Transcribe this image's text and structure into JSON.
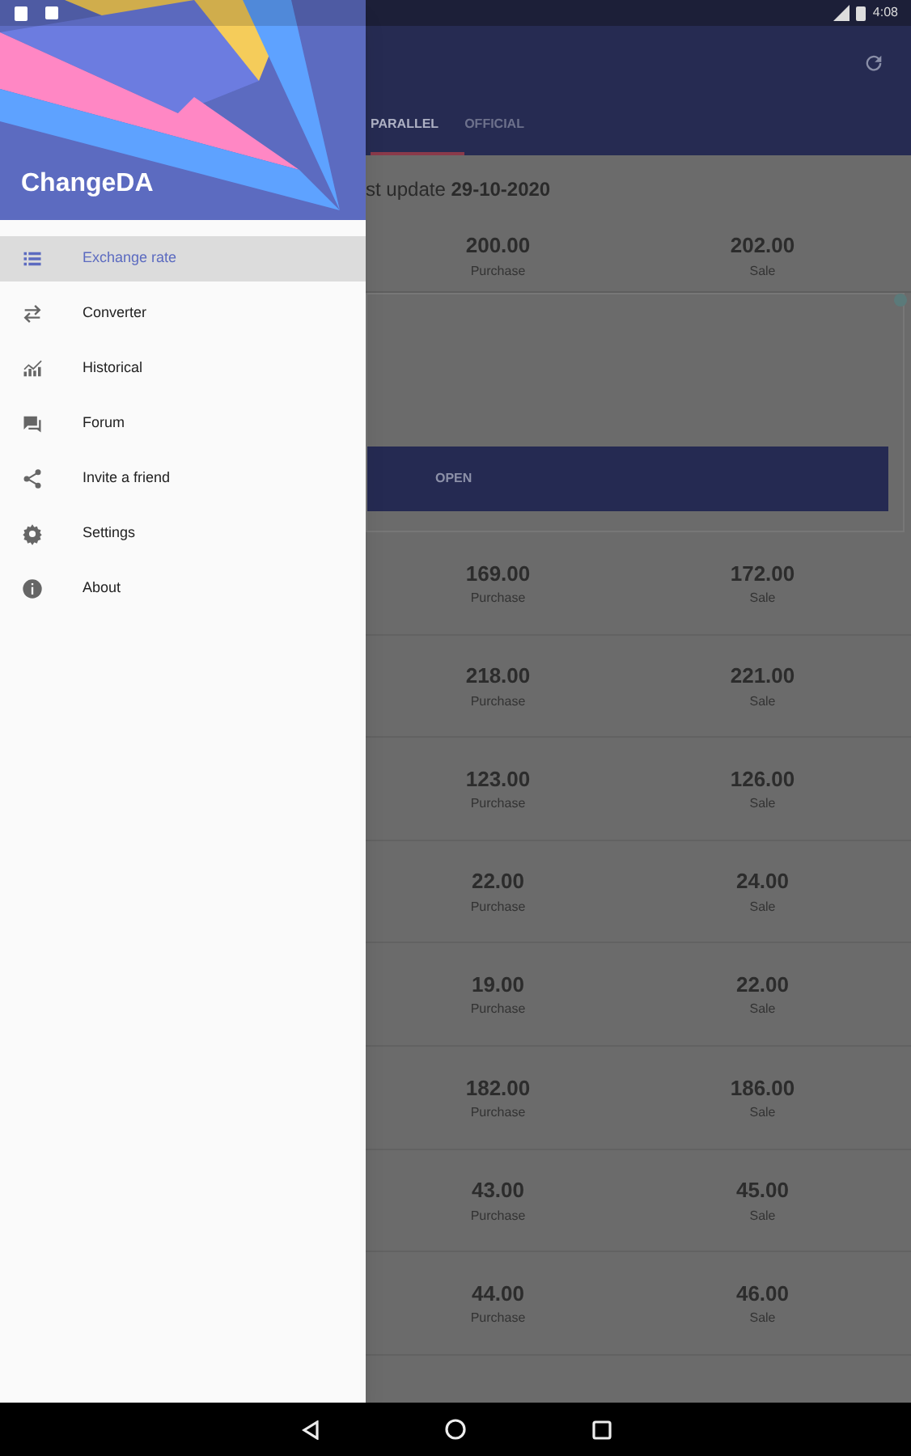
{
  "status_bar": {
    "time": "4:08"
  },
  "drawer": {
    "title": "ChangeDA",
    "items": [
      {
        "label": "Exchange rate",
        "kind": "list",
        "selected": true
      },
      {
        "label": "Converter",
        "kind": "swap",
        "selected": false
      },
      {
        "label": "Historical",
        "kind": "chart",
        "selected": false
      },
      {
        "label": "Forum",
        "kind": "forum",
        "selected": false
      },
      {
        "label": "Invite a friend",
        "kind": "share",
        "selected": false
      },
      {
        "label": "Settings",
        "kind": "settings",
        "selected": false
      },
      {
        "label": "About",
        "kind": "info",
        "selected": false
      }
    ]
  },
  "main": {
    "tabs": [
      {
        "label": "PARALLEL",
        "selected": true
      },
      {
        "label": "OFFICIAL",
        "selected": false
      }
    ],
    "last_update": "st update **29-10-2020**",
    "rows": [
      {
        "kind": "rate",
        "purchase": "200.00",
        "purchase_label": "Purchase",
        "sale": "202.00",
        "sale_label": "Sale"
      },
      {
        "kind": "ad",
        "button": "OPEN"
      },
      {
        "kind": "rate",
        "purchase": "169.00",
        "purchase_label": "Purchase",
        "sale": "172.00",
        "sale_label": "Sale"
      },
      {
        "kind": "rate",
        "purchase": "218.00",
        "purchase_label": "Purchase",
        "sale": "221.00",
        "sale_label": "Sale"
      },
      {
        "kind": "rate",
        "purchase": "123.00",
        "purchase_label": "Purchase",
        "sale": "126.00",
        "sale_label": "Sale"
      },
      {
        "kind": "rate",
        "purchase": "22.00",
        "purchase_label": "Purchase",
        "sale": "24.00",
        "sale_label": "Sale"
      },
      {
        "kind": "rate",
        "purchase": "19.00",
        "purchase_label": "Purchase",
        "sale": "22.00",
        "sale_label": "Sale"
      },
      {
        "kind": "rate",
        "purchase": "182.00",
        "purchase_label": "Purchase",
        "sale": "186.00",
        "sale_label": "Sale"
      },
      {
        "kind": "rate",
        "purchase": "43.00",
        "purchase_label": "Purchase",
        "sale": "45.00",
        "sale_label": "Sale"
      },
      {
        "kind": "rate",
        "purchase": "44.00",
        "purchase_label": "Purchase",
        "sale": "46.00",
        "sale_label": "Sale"
      }
    ]
  }
}
